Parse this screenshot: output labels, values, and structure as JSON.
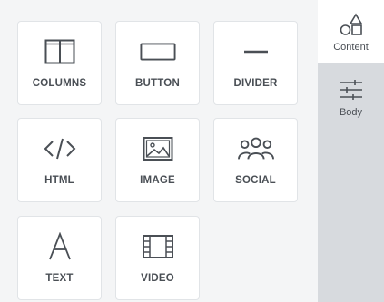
{
  "tools": [
    {
      "label": "COLUMNS",
      "icon": "columns-icon"
    },
    {
      "label": "BUTTON",
      "icon": "button-icon"
    },
    {
      "label": "DIVIDER",
      "icon": "divider-icon"
    },
    {
      "label": "HTML",
      "icon": "code-icon"
    },
    {
      "label": "IMAGE",
      "icon": "image-icon"
    },
    {
      "label": "SOCIAL",
      "icon": "people-icon"
    },
    {
      "label": "TEXT",
      "icon": "letter-a-icon"
    },
    {
      "label": "VIDEO",
      "icon": "film-icon"
    }
  ],
  "sidebar": {
    "tabs": [
      {
        "label": "Content",
        "icon": "shapes-icon",
        "active": true
      },
      {
        "label": "Body",
        "icon": "sliders-icon",
        "active": false
      }
    ]
  },
  "colors": {
    "panel_bg": "#f4f5f6",
    "tile_bg": "#ffffff",
    "tile_border": "#e1e4e7",
    "sidebar_bg": "#d7dade",
    "text": "#4a4f55"
  }
}
